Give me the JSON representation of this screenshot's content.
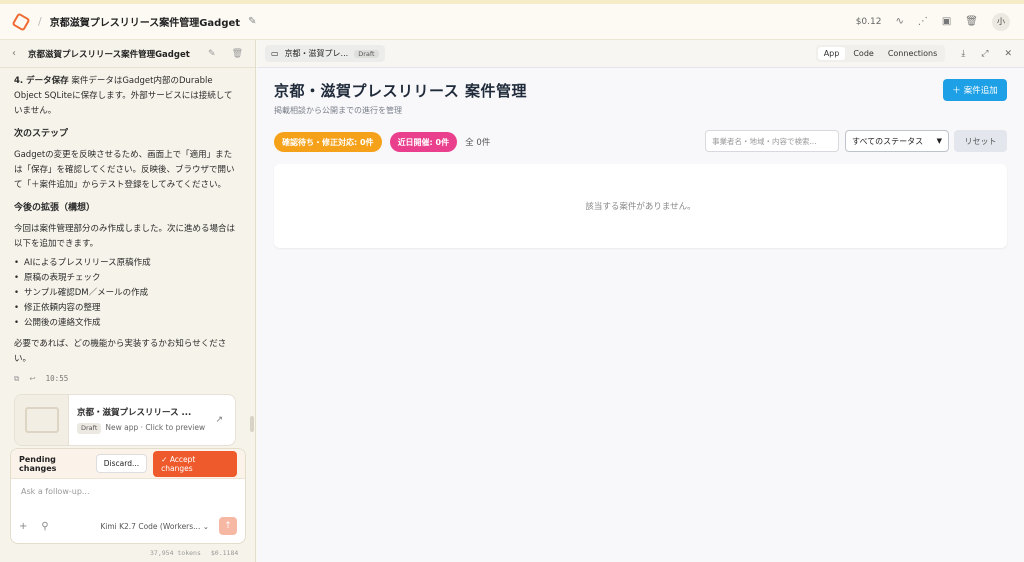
{
  "topbar": {
    "app_title": "京都滋賀プレスリリース案件管理Gadget",
    "cost": "$0.12",
    "avatar": "小"
  },
  "left": {
    "header_title": "京都滋賀プレスリリース案件管理Gadget",
    "data_save_label": "4. データ保存",
    "data_save_text": "案件データはGadget内部のDurable Object SQLiteに保存します。外部サービスには接続していません。",
    "next_steps_title": "次のステップ",
    "next_steps_text": "Gadgetの変更を反映させるため、画面上で「適用」または「保存」を確認してください。反映後、ブラウザで開いて「＋案件追加」からテスト登録をしてみてください。",
    "future_title": "今後の拡張（構想）",
    "future_text": "今回は案件管理部分のみ作成しました。次に進める場合は以下を追加できます。",
    "future_items": [
      "AIによるプレスリリース原稿作成",
      "原稿の表現チェック",
      "サンプル確認DM／メールの作成",
      "修正依頼内容の整理",
      "公開後の連絡文作成"
    ],
    "closing_text": "必要であれば、どの機能から実装するかお知らせください。",
    "time": "10:55",
    "card": {
      "name": "京都・滋賀プレスリリース ...",
      "badge": "Draft",
      "desc": "New app · Click to preview"
    },
    "pending": {
      "label": "Pending changes",
      "discard": "Discard...",
      "accept": "Accept changes",
      "placeholder": "Ask a follow-up...",
      "model": "Kimi K2.7 Code (Workers..."
    },
    "tokens": "37,954 tokens",
    "token_cost": "$0.1184"
  },
  "right": {
    "file_tab": "京都・滋賀プレ...",
    "file_badge": "Draft",
    "view_tabs": [
      "App",
      "Code",
      "Connections"
    ],
    "page_title": "京都・滋賀プレスリリース 案件管理",
    "page_sub": "掲載相談から公開までの進行を管理",
    "add_button": "案件追加",
    "chip_pending": "確認待ち・修正対応: 0件",
    "chip_upcoming": "近日開催: 0件",
    "total": "全 0件",
    "search_placeholder": "事業者名・地域・内容で検索...",
    "status_select": "すべてのステータス",
    "reset": "リセット",
    "empty_message": "該当する案件がありません。"
  },
  "colors": {
    "accent_orange": "#ef5a2c",
    "add_blue": "#1ea0e6",
    "chip_orange": "#f5a21a",
    "chip_pink": "#ea3f8c"
  }
}
